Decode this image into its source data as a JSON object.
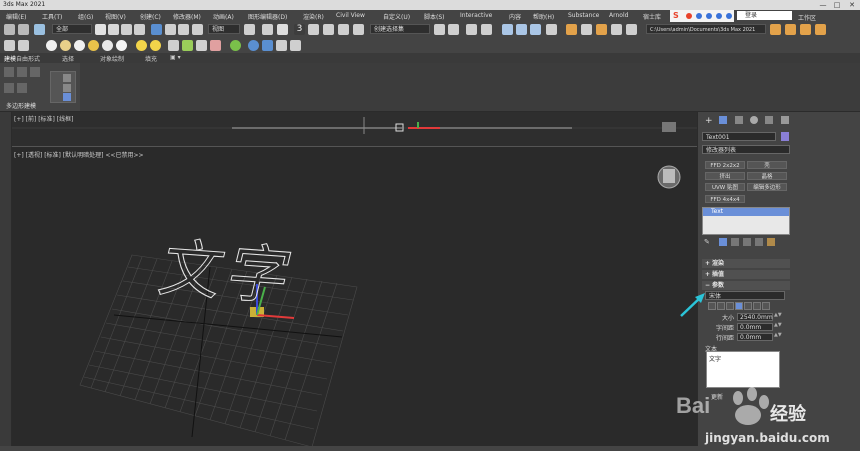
{
  "window": {
    "title": "3ds Max 2021",
    "minimize": "—",
    "maximize": "□",
    "close": "✕"
  },
  "menu": [
    "编辑(E)",
    "工具(T)",
    "组(G)",
    "视图(V)",
    "创建(C)",
    "修改器(M)",
    "动画(A)",
    "图形编辑器(D)",
    "渲染(R)",
    "Civil View",
    "自定义(U)",
    "脚本(S)",
    "Interactive",
    "内容",
    "帮助(H)",
    "Substance",
    "Arnold",
    "宿士库"
  ],
  "ime": {
    "label": "S"
  },
  "login": {
    "placeholder": "登录"
  },
  "workspace": {
    "label": "工作区"
  },
  "toolbar": {
    "selection_filter": "全部",
    "view_dropdown": "视图",
    "snap_count": "3",
    "selection_set": "创建选择集",
    "project_path": "C:\\Users\\admin\\Documents\\3ds Max 2021"
  },
  "ribbon": {
    "tabs": [
      "建模",
      "自由形式",
      "选择",
      "对象绘制",
      "填充"
    ],
    "group_label": "多边形建模"
  },
  "viewports": {
    "top_label": "[+] [前] [标准] [线框]",
    "main_label": "[+] [透视] [标准] [默认明暗处理]  <<已禁用>>"
  },
  "panel": {
    "object_name": "Text001",
    "object_color": "#8a7fd6",
    "modifier_list": "修改器列表",
    "modifier_buttons": [
      "FFD 2x2x2",
      "壳",
      "挤出",
      "晶格",
      "UVW 贴图",
      "编辑多边形",
      "FFD 4x4x4"
    ],
    "stack_item": "Text",
    "rollouts": [
      "渲染",
      "插值",
      "参数"
    ],
    "font": "宋体",
    "params": [
      {
        "label": "大小",
        "value": "2540.0mm"
      },
      {
        "label": "字间距",
        "value": "0.0mm"
      },
      {
        "label": "行间距",
        "value": "0.0mm"
      }
    ],
    "text_label": "文本",
    "text_value": "文字",
    "update_label": "更新"
  },
  "scene_text": "文字",
  "watermark": {
    "brand": "经验",
    "url": "jingyan.baidu.com",
    "logo": "Bai"
  }
}
